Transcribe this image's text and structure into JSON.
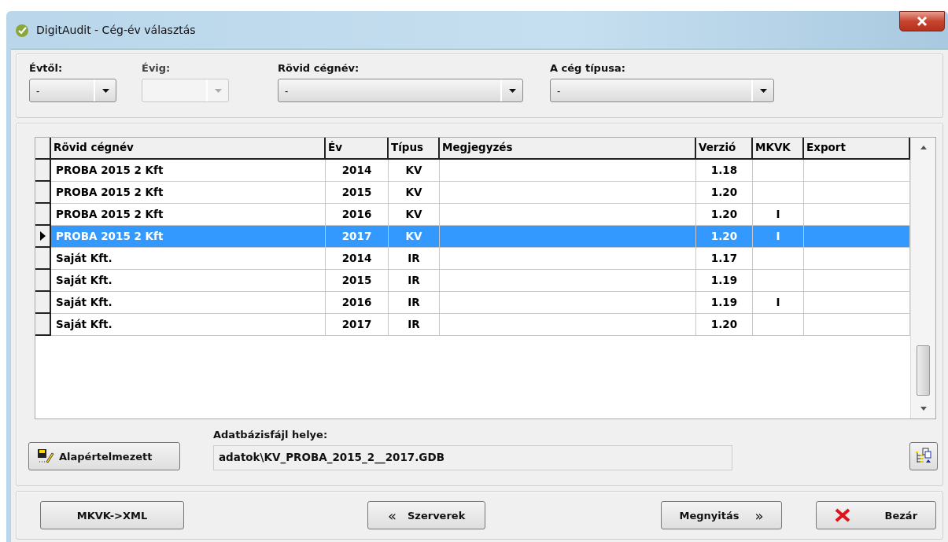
{
  "window": {
    "title": "DigitAudit - Cég-év választás"
  },
  "filters": [
    {
      "label": "Évtől:",
      "value": "-",
      "disabled": false
    },
    {
      "label": "Évig:",
      "disabled": true
    },
    {
      "label": "Rövid cégnév:",
      "value": "-",
      "disabled": false
    },
    {
      "label": "A cég típusa:",
      "value": "-",
      "disabled": false
    }
  ],
  "table": {
    "columns": [
      "Rövid cégnév",
      "Év",
      "Típus",
      "Megjegyzés",
      "Verzió",
      "MKVK",
      "Export"
    ],
    "rows": [
      {
        "name": "PROBA 2015 2 Kft",
        "year": "2014",
        "type": "KV",
        "version": "1.18",
        "selected": false
      },
      {
        "name": "PROBA 2015 2 Kft",
        "year": "2015",
        "type": "KV",
        "version": "1.20",
        "selected": false
      },
      {
        "name": "PROBA 2015 2 Kft",
        "year": "2016",
        "type": "KV",
        "version": "1.20",
        "mkvk": "I",
        "selected": false
      },
      {
        "name": "PROBA 2015 2 Kft",
        "year": "2017",
        "type": "KV",
        "version": "1.20",
        "mkvk": "I",
        "selected": true
      },
      {
        "name": "Saját Kft.",
        "year": "2014",
        "type": "IR",
        "version": "1.17",
        "selected": false
      },
      {
        "name": "Saját Kft.",
        "year": "2015",
        "type": "IR",
        "version": "1.19",
        "selected": false
      },
      {
        "name": "Saját Kft.",
        "year": "2016",
        "type": "IR",
        "version": "1.19",
        "mkvk": "I",
        "selected": false
      },
      {
        "name": "Saját Kft.",
        "year": "2017",
        "type": "IR",
        "version": "1.20",
        "selected": false
      }
    ]
  },
  "default_button": "Alapértelmezett",
  "db_path": {
    "label": "Adatbázisfájl helye:",
    "value": "adatok\\KV_PROBA_2015_2__2017.GDB"
  },
  "buttons": [
    {
      "label": "MKVK->XML",
      "kind": "plain"
    },
    {
      "label": "Szerverek",
      "kind": "back"
    },
    {
      "label": "Megnyitás",
      "kind": "forward"
    },
    {
      "label": "Bezár",
      "kind": "close"
    }
  ],
  "button_glyphs": {
    "back": "«",
    "forward": "»"
  }
}
